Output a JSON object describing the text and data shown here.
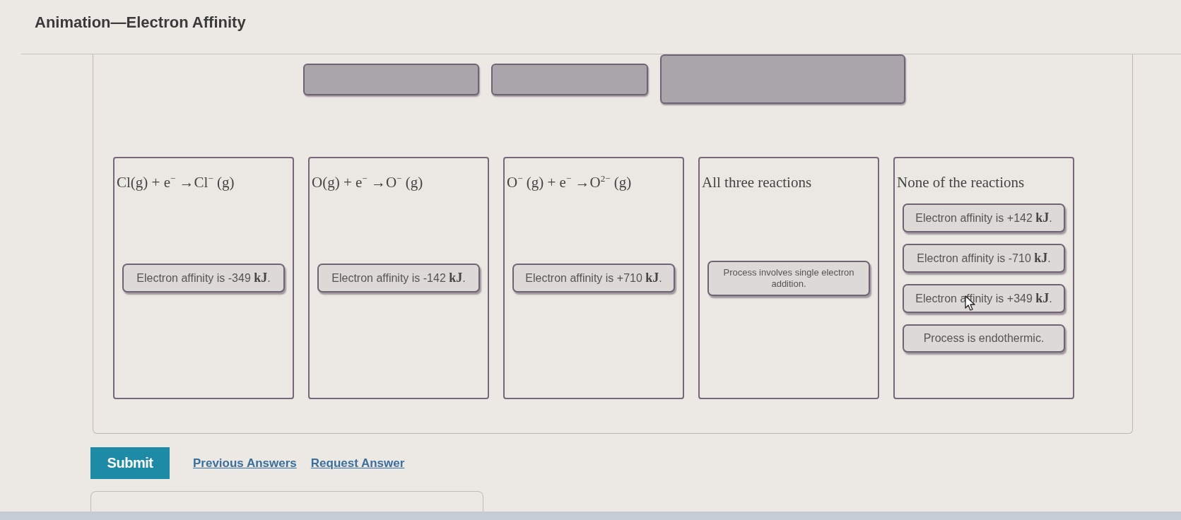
{
  "page": {
    "title": "Animation—Electron Affinity"
  },
  "drop_slots": [
    {
      "kind": "wide"
    },
    {
      "kind": "medium"
    },
    {
      "kind": "large"
    }
  ],
  "categories": [
    {
      "label": "Cl(g) + e$^{−}$ →Cl$^{−}$ (g)",
      "items": [
        {
          "text": "Electron affinity is -349 **kJ**.",
          "hovered": false
        }
      ]
    },
    {
      "label": "O(g) + e$^{−}$ →O$^{−}$ (g)",
      "items": [
        {
          "text": "Electron affinity is -142 **kJ**.",
          "hovered": false
        }
      ]
    },
    {
      "label": "O$^{−}$ (g) + e$^{−}$ →O$^{2−}$ (g)",
      "items": [
        {
          "text": "Electron affinity is +710 **kJ**.",
          "hovered": false
        }
      ]
    },
    {
      "label": "All three reactions",
      "items": [
        {
          "text": "Process involves single electron addition.",
          "hovered": false
        }
      ]
    },
    {
      "label": "None of the reactions",
      "items": [
        {
          "text": "Electron affinity is +142 **kJ**.",
          "hovered": false
        },
        {
          "text": "Electron affinity is -710 **kJ**.",
          "hovered": false
        },
        {
          "text": "Electron affinity is +349 **kJ**.",
          "hovered": true
        },
        {
          "text": "Process is endothermic.",
          "hovered": false
        }
      ]
    }
  ],
  "actions": {
    "submit": "Submit",
    "links": [
      "Previous Answers",
      "Request Answer"
    ]
  }
}
